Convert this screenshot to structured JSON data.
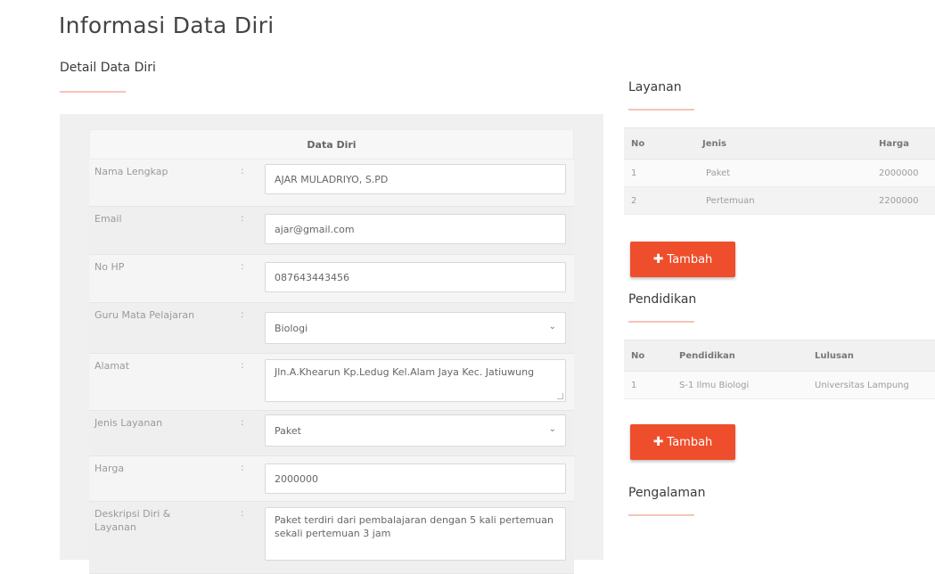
{
  "page": {
    "title": "Informasi Data Diri"
  },
  "left": {
    "section_title": "Detail Data Diri",
    "table_header": "Data Diri",
    "rows": [
      {
        "label": "Nama Lengkap",
        "value": "AJAR MULADRIYO, S.PD",
        "type": "text"
      },
      {
        "label": "Email",
        "value": "ajar@gmail.com",
        "type": "text"
      },
      {
        "label": "No HP",
        "value": "087643443456",
        "type": "text"
      },
      {
        "label": "Guru Mata Pelajaran",
        "value": "Biologi",
        "type": "select"
      },
      {
        "label": "Alamat",
        "value": "Jln.A.Khearun Kp.Ledug Kel.Alam Jaya Kec. Jatiuwung",
        "type": "textarea"
      },
      {
        "label": "Jenis Layanan",
        "value": "Paket",
        "type": "select"
      },
      {
        "label": "Harga",
        "value": "2000000",
        "type": "text"
      },
      {
        "label": "Deskripsi Diri & Layanan",
        "value": "Paket terdiri dari pembalajaran dengan 5 kali pertemuan sekali pertemuan 3 jam",
        "type": "textarea"
      }
    ],
    "colon": ":"
  },
  "layanan": {
    "title": "Layanan",
    "headers": [
      "No",
      "Jenis",
      "Harga"
    ],
    "rows": [
      [
        "1",
        "Paket",
        "2000000"
      ],
      [
        "2",
        "Pertemuan",
        "2200000"
      ]
    ],
    "button_label": "Tambah"
  },
  "pendidikan": {
    "title": "Pendidikan",
    "headers": [
      "No",
      "Pendidikan",
      "Lulusan"
    ],
    "rows": [
      [
        "1",
        "S-1 Ilmu Biologi",
        "Universitas Lampung"
      ]
    ],
    "button_label": "Tambah"
  },
  "pengalaman": {
    "title": "Pengalaman"
  },
  "colors": {
    "accent": "#ee4e2b",
    "underline": "#f6c4b8"
  },
  "icons": {
    "add": "plus-icon",
    "select": "chevron-down-icon"
  }
}
